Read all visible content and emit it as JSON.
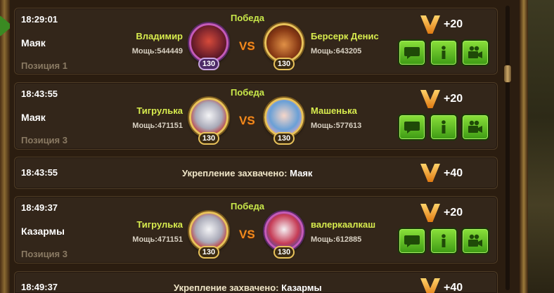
{
  "battles": [
    {
      "time": "18:29:01",
      "place": "Маяк",
      "position": "Позиция 1",
      "result": "Победа",
      "left": {
        "name": "Владимир",
        "power": "Мощь:544449",
        "level": "130"
      },
      "vs": "VS",
      "right": {
        "name": "Берсерк Денис",
        "power": "Мощь:643205",
        "level": "130"
      },
      "reward": "+20"
    },
    {
      "time": "18:43:55",
      "place": "Маяк",
      "position": "Позиция 3",
      "result": "Победа",
      "left": {
        "name": "Тигрулька",
        "power": "Мощь:471151",
        "level": "130"
      },
      "vs": "VS",
      "right": {
        "name": "Машенька",
        "power": "Мощь:577613",
        "level": "130"
      },
      "reward": "+20"
    },
    {
      "time": "18:49:37",
      "place": "Казармы",
      "position": "Позиция 3",
      "result": "Победа",
      "left": {
        "name": "Тигрулька",
        "power": "Мощь:471151",
        "level": "130"
      },
      "vs": "VS",
      "right": {
        "name": "валеркаалкаш",
        "power": "Мощь:612885",
        "level": "130"
      },
      "reward": "+20"
    }
  ],
  "events": [
    {
      "time": "18:43:55",
      "text": "Укрепление захвачено: ",
      "place": "Маяк",
      "reward": "+40"
    },
    {
      "time": "18:49:37",
      "text": "Укрепление захвачено: ",
      "place": "Казармы",
      "reward": "+40"
    }
  ],
  "icons": {
    "chat": "speech-bubble-icon",
    "info": "info-icon",
    "replay": "video-camera-icon",
    "reward": "valor-v-icon"
  },
  "colors": {
    "accent_green": "#5cc420",
    "name_yellow": "#d8ec4e",
    "vs_orange": "#f08a1e"
  }
}
